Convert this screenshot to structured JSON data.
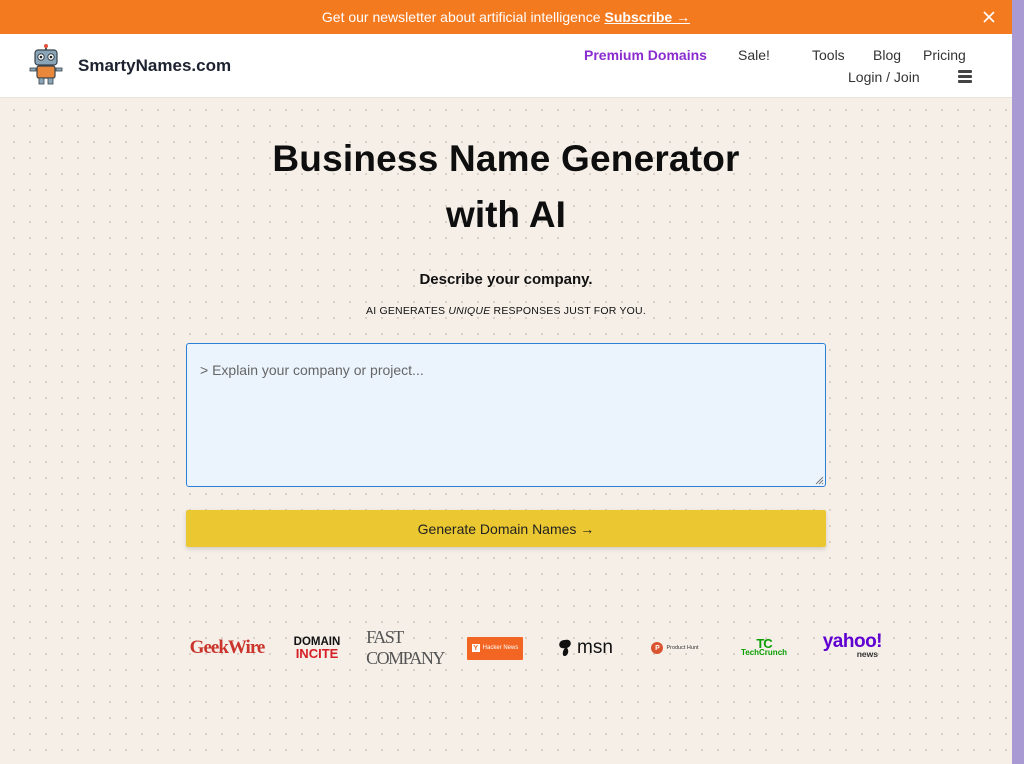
{
  "banner": {
    "text": "Get our newsletter about artificial intelligence",
    "subscribe": "Subscribe →"
  },
  "header": {
    "brand": "SmartyNames.com",
    "nav": {
      "premium": "Premium Domains",
      "sale": "Sale!",
      "tools": "Tools",
      "blog": "Blog",
      "pricing": "Pricing",
      "login": "Login / Join"
    }
  },
  "hero": {
    "title_line1": "Business Name Generator",
    "title_line2": "with AI",
    "describe": "Describe your company.",
    "tag_pre": "AI GENERATES ",
    "tag_em": "UNIQUE",
    "tag_post": " RESPONSES JUST FOR YOU."
  },
  "form": {
    "placeholder": "> Explain your company or project...",
    "value": "",
    "button": "Generate Domain Names →"
  },
  "press": {
    "geekwire": "GeekWire",
    "domain1": "DOMAIN",
    "domain2": "INCITE",
    "fast": "FAST COMPANY",
    "hn": "Hacker News",
    "hn_y": "Y",
    "msn": "msn",
    "ph_p": "P",
    "ph": "Product Hunt",
    "tc1": "TC",
    "tc2": "TechCrunch",
    "yahoo1": "yahoo!",
    "yahoo2": "news"
  },
  "colors": {
    "banner": "#f47a20",
    "premium": "#8a2ccf",
    "highlight": "#39b86f",
    "button": "#ebc831",
    "textarea_bg": "#ebf4fd",
    "textarea_border": "#2c7fd9"
  }
}
